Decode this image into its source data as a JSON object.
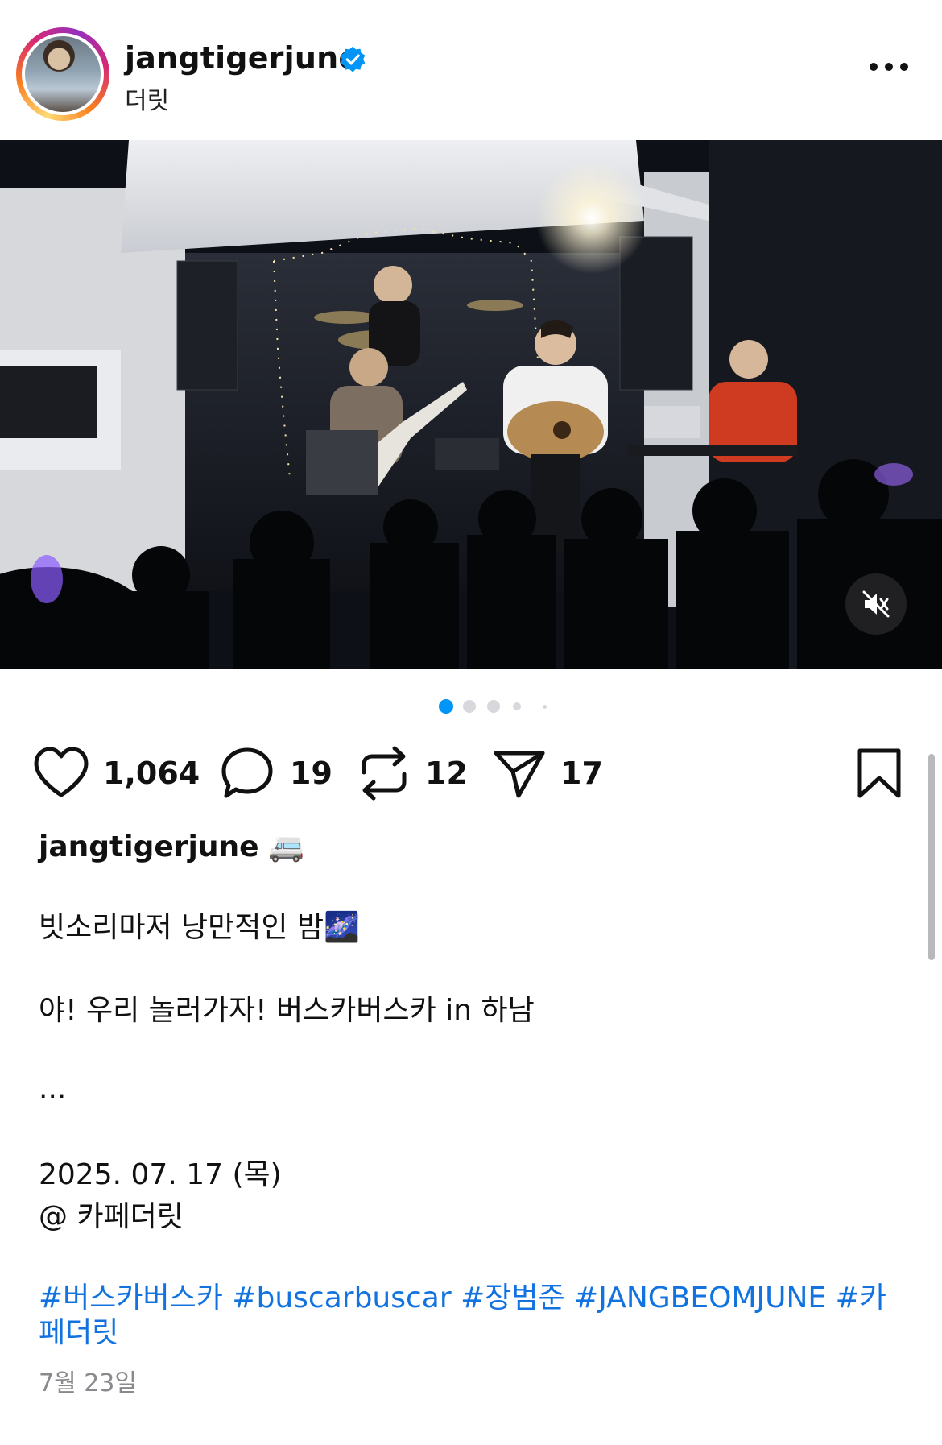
{
  "header": {
    "username": "jangtigerjune",
    "subtitle": "더릿",
    "verified": true
  },
  "media": {
    "description_icon": "mute-icon",
    "carousel": {
      "count": 5,
      "active_index": 0
    }
  },
  "actions": {
    "likes": "1,064",
    "comments": "19",
    "reposts": "12",
    "shares": "17"
  },
  "caption": {
    "username": "jangtigerjune",
    "username_emoji": "🚐",
    "line1": "빗소리마저 낭만적인 밤",
    "line1_emoji": "🌌",
    "line2": "야! 우리 놀러가자! 버스카버스카 in 하남",
    "ellipsis": "...",
    "date_line": "2025. 07. 17 (목)",
    "place_line": "@ 카페더릿",
    "hashtags_line1": "#버스카버스카 #buscarbuscar #장범준 #JANGBEOMJUNE #카",
    "hashtags_line2": "페더릿"
  },
  "post_date": "7월 23일",
  "colors": {
    "accent_blue": "#1273e0",
    "verified_blue": "#0095f6",
    "dot_active": "#0095f6"
  }
}
